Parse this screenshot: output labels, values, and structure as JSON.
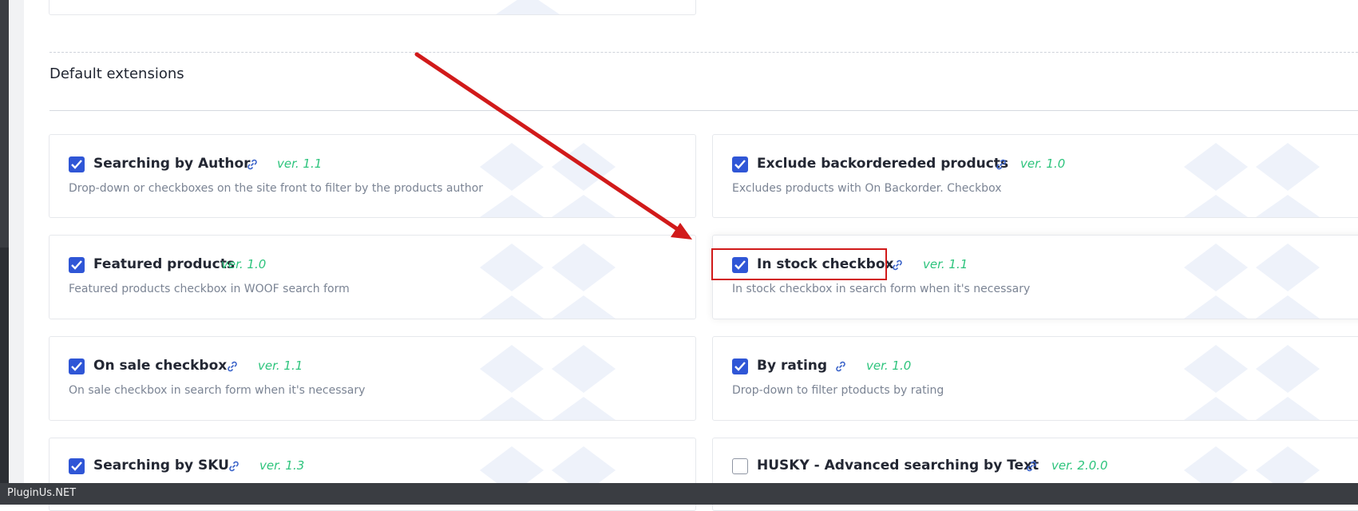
{
  "section": {
    "title": "Default extensions"
  },
  "extensions": [
    {
      "title": "Searching by Author",
      "version": "ver. 1.1",
      "description": "Drop-down or checkboxes on the site front to filter by the products author",
      "checked": true
    },
    {
      "title": "Exclude backorderedеd products",
      "version": "ver. 1.0",
      "description": "Excludes products with On Backorder. Checkbox",
      "checked": true
    },
    {
      "title": "Featured products",
      "version": "ver. 1.0",
      "description": "Featured products checkbox in WOOF search form",
      "checked": true
    },
    {
      "title": "In stock checkbox",
      "version": "ver. 1.1",
      "description": "In stock checkbox in search form when it's necessary",
      "checked": true
    },
    {
      "title": "On sale checkbox",
      "version": "ver. 1.1",
      "description": "On sale checkbox in search form when it's necessary",
      "checked": true
    },
    {
      "title": "By rating",
      "version": "ver. 1.0",
      "description": "Drop-down to filter ptoducts by rating",
      "checked": true
    },
    {
      "title": "Searching by SKU",
      "version": "ver. 1.3",
      "description": "",
      "checked": true
    },
    {
      "title": "HUSKY - Advanced searching by Text",
      "version": "ver. 2.0.0",
      "description": "",
      "checked": false
    }
  ],
  "footer": {
    "brand": "PluginUs.NET"
  },
  "colors": {
    "accent": "#2f56d6",
    "version": "#2ec47d",
    "annotation": "#d11a1a"
  },
  "icons": {
    "check": "check-icon",
    "link": "link-icon",
    "watermark": "watermark-pattern"
  }
}
